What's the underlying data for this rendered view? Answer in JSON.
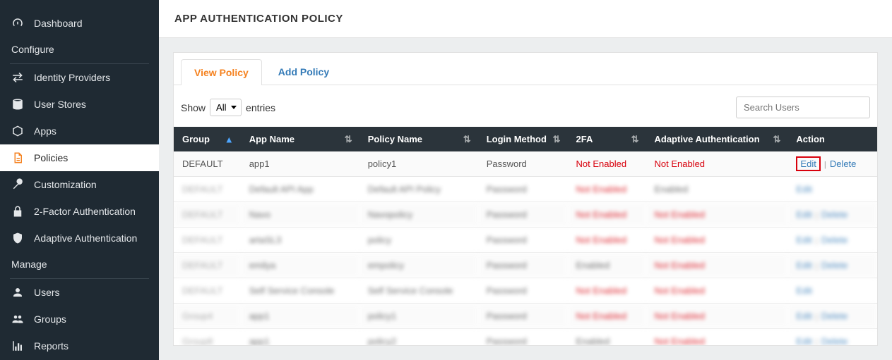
{
  "sidebar": {
    "items": [
      {
        "label": "Dashboard"
      },
      {
        "label": "Identity Providers"
      },
      {
        "label": "User Stores"
      },
      {
        "label": "Apps"
      },
      {
        "label": "Policies"
      },
      {
        "label": "Customization"
      },
      {
        "label": "2-Factor Authentication"
      },
      {
        "label": "Adaptive Authentication"
      },
      {
        "label": "Users"
      },
      {
        "label": "Groups"
      },
      {
        "label": "Reports"
      }
    ],
    "sections": {
      "configure": "Configure",
      "manage": "Manage"
    }
  },
  "header": {
    "title": "APP AUTHENTICATION POLICY"
  },
  "tabs": {
    "view": "View Policy",
    "add": "Add Policy"
  },
  "controls": {
    "show": "Show",
    "entries": "entries",
    "select": "All",
    "search_placeholder": "Search Users"
  },
  "columns": {
    "group": "Group",
    "app": "App Name",
    "policy": "Policy Name",
    "login": "Login Method",
    "twofa": "2FA",
    "adaptive": "Adaptive Authentication",
    "action": "Action"
  },
  "rows": [
    {
      "group": "DEFAULT",
      "app": "app1",
      "policy": "policy1",
      "login": "Password",
      "twofa": "Not Enabled",
      "adaptive": "Not Enabled",
      "edit": "Edit",
      "del": "Delete",
      "blur": false,
      "hi": true
    },
    {
      "group": "DEFAULT",
      "app": "Default API App",
      "policy": "Default API Policy",
      "login": "Password",
      "twofa": "Not Enabled",
      "adaptive": "Enabled",
      "edit": "Edit",
      "del": "",
      "blur": true
    },
    {
      "group": "DEFAULT",
      "app": "Navo",
      "policy": "Navopolicy",
      "login": "Password",
      "twofa": "Not Enabled",
      "adaptive": "Not Enabled",
      "edit": "Edit",
      "del": "Delete",
      "blur": true
    },
    {
      "group": "DEFAULT",
      "app": "artaSL3",
      "policy": "policy",
      "login": "Password",
      "twofa": "Not Enabled",
      "adaptive": "Not Enabled",
      "edit": "Edit",
      "del": "Delete",
      "blur": true
    },
    {
      "group": "DEFAULT",
      "app": "emilya",
      "policy": "empolicy",
      "login": "Password",
      "twofa": "Enabled",
      "adaptive": "Not Enabled",
      "edit": "Edit",
      "del": "Delete",
      "blur": true
    },
    {
      "group": "DEFAULT",
      "app": "Self Service Console",
      "policy": "Self Service Console",
      "login": "Password",
      "twofa": "Not Enabled",
      "adaptive": "Not Enabled",
      "edit": "Edit",
      "del": "",
      "blur": true
    },
    {
      "group": "Group4",
      "app": "app1",
      "policy": "policy1",
      "login": "Password",
      "twofa": "Not Enabled",
      "adaptive": "Not Enabled",
      "edit": "Edit",
      "del": "Delete",
      "blur": true
    },
    {
      "group": "Group8",
      "app": "app1",
      "policy": "policy2",
      "login": "Password",
      "twofa": "Enabled",
      "adaptive": "Not Enabled",
      "edit": "Edit",
      "del": "Delete",
      "blur": true
    }
  ]
}
